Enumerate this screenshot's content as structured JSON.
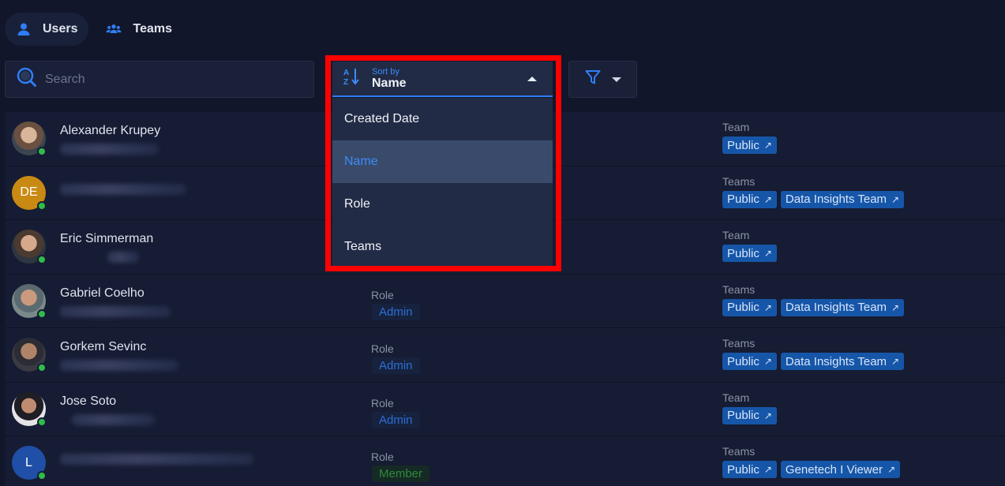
{
  "tabs": [
    {
      "label": "Users",
      "icon": "user-icon",
      "active": true
    },
    {
      "label": "Teams",
      "icon": "team-icon",
      "active": false
    }
  ],
  "search": {
    "placeholder": "Search",
    "value": ""
  },
  "sort": {
    "caption": "Sort by",
    "value": "Name",
    "options": [
      "Created Date",
      "Name",
      "Role",
      "Teams"
    ],
    "selected": "Name"
  },
  "filter": {
    "icon": "filter-icon"
  },
  "users": [
    {
      "name": "Alexander Krupey",
      "avatar_initials": "",
      "role_label": "",
      "role": "",
      "teams_label": "Team",
      "teams": [
        "Public"
      ]
    },
    {
      "name": "",
      "avatar_initials": "DE",
      "role_label": "",
      "role": "",
      "teams_label": "Teams",
      "teams": [
        "Public",
        "Data Insights Team"
      ]
    },
    {
      "name": "Eric Simmerman",
      "avatar_initials": "",
      "role_label": "",
      "role": "",
      "teams_label": "Team",
      "teams": [
        "Public"
      ]
    },
    {
      "name": "Gabriel Coelho",
      "avatar_initials": "",
      "role_label": "Role",
      "role": "Admin",
      "teams_label": "Teams",
      "teams": [
        "Public",
        "Data Insights Team"
      ]
    },
    {
      "name": "Gorkem Sevinc",
      "avatar_initials": "",
      "role_label": "Role",
      "role": "Admin",
      "teams_label": "Teams",
      "teams": [
        "Public",
        "Data Insights Team"
      ]
    },
    {
      "name": "Jose Soto",
      "avatar_initials": "",
      "role_label": "Role",
      "role": "Admin",
      "teams_label": "Team",
      "teams": [
        "Public"
      ]
    },
    {
      "name": "",
      "avatar_initials": "L",
      "role_label": "Role",
      "role": "Member",
      "teams_label": "Teams",
      "teams": [
        "Public",
        "Genetech I Viewer"
      ]
    }
  ],
  "colors": {
    "accent": "#3b8cf7",
    "chip": "#1656a8",
    "highlight": "#ff0000",
    "online": "#2fbd4a"
  }
}
